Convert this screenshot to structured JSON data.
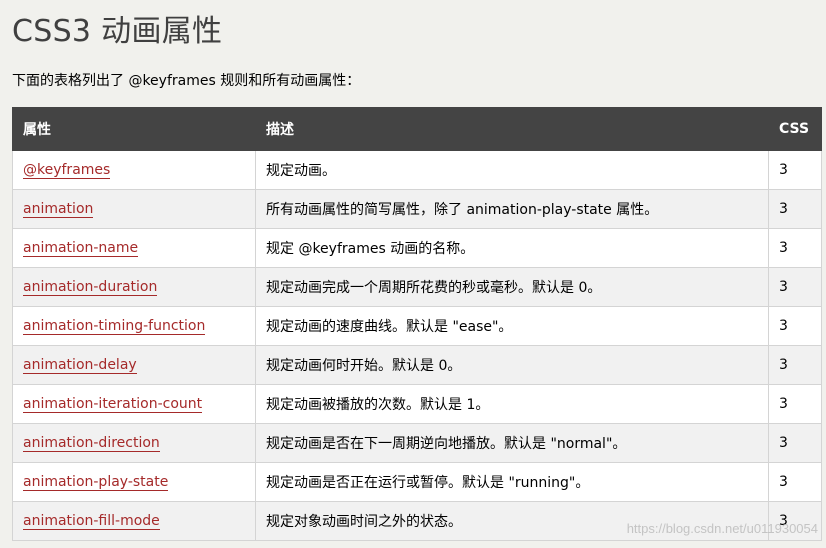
{
  "page": {
    "title": "CSS3 动画属性",
    "intro": "下面的表格列出了 @keyframes 规则和所有动画属性："
  },
  "table": {
    "headers": [
      "属性",
      "描述",
      "CSS"
    ],
    "rows": [
      {
        "property": "@keyframes",
        "description": "规定动画。",
        "css": "3"
      },
      {
        "property": "animation",
        "description": "所有动画属性的简写属性，除了 animation-play-state 属性。",
        "css": "3"
      },
      {
        "property": "animation-name",
        "description": "规定 @keyframes 动画的名称。",
        "css": "3"
      },
      {
        "property": "animation-duration",
        "description": "规定动画完成一个周期所花费的秒或毫秒。默认是 0。",
        "css": "3"
      },
      {
        "property": "animation-timing-function",
        "description": "规定动画的速度曲线。默认是 \"ease\"。",
        "css": "3"
      },
      {
        "property": "animation-delay",
        "description": "规定动画何时开始。默认是 0。",
        "css": "3"
      },
      {
        "property": "animation-iteration-count",
        "description": "规定动画被播放的次数。默认是 1。",
        "css": "3"
      },
      {
        "property": "animation-direction",
        "description": "规定动画是否在下一周期逆向地播放。默认是 \"normal\"。",
        "css": "3"
      },
      {
        "property": "animation-play-state",
        "description": "规定动画是否正在运行或暂停。默认是 \"running\"。",
        "css": "3"
      },
      {
        "property": "animation-fill-mode",
        "description": "规定对象动画时间之外的状态。",
        "css": "3"
      }
    ]
  },
  "watermark": "https://blog.csdn.net/u011930054",
  "colors": {
    "header_bg": "#444444",
    "link": "#a52a2a",
    "page_bg": "#f1f1ed"
  }
}
